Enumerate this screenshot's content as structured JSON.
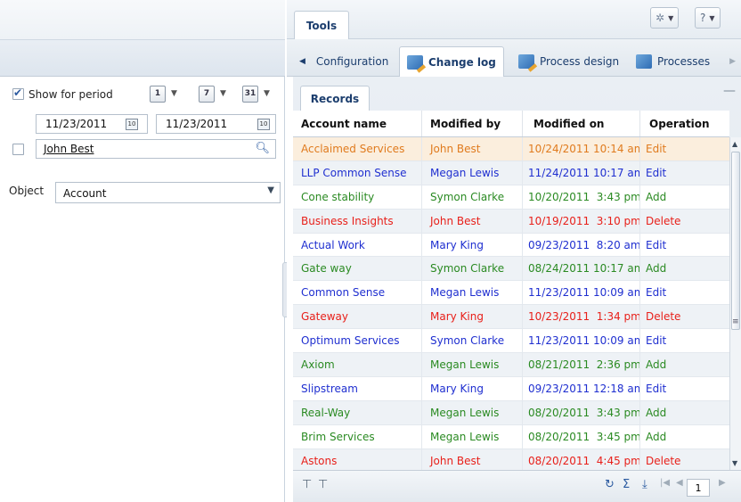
{
  "filters": {
    "show_for_period_label": "Show for period",
    "show_for_period_checked": true,
    "period_buttons": [
      {
        "icon": "day-calendar-icon",
        "label": "1"
      },
      {
        "icon": "week-calendar-icon",
        "label": "7"
      },
      {
        "icon": "month-calendar-icon",
        "label": "31"
      }
    ],
    "date_from": "11/23/2011",
    "date_to": "11/23/2011",
    "user_value": "John Best",
    "object_label": "Object",
    "object_value": "Account"
  },
  "tools": {
    "tab_label": "Tools"
  },
  "process_tabs": [
    {
      "label": "Configuration",
      "icon": "arrow-left-icon",
      "active": false
    },
    {
      "label": "Change log",
      "icon": "change-log-icon",
      "active": true
    },
    {
      "label": "Process design",
      "icon": "process-design-icon",
      "active": false
    },
    {
      "label": "Processes",
      "icon": "processes-icon",
      "active": false
    }
  ],
  "records": {
    "tab_label": "Records",
    "columns": [
      "Account name",
      "Modified by",
      "Modified on",
      "Operation"
    ],
    "rows": [
      {
        "account": "Acclaimed Services",
        "modified_by": "John Best",
        "modified_on": "10/24/2011 10:14 am",
        "operation": "Edit",
        "color": "#e07b1e",
        "selected": true
      },
      {
        "account": "LLP Common Sense",
        "modified_by": "Megan Lewis",
        "modified_on": "11/24/2011 10:17 am",
        "operation": "Edit",
        "color": "#1f2fd0"
      },
      {
        "account": "Cone stability",
        "modified_by": "Symon Clarke",
        "modified_on": "10/20/2011  3:43 pm",
        "operation": "Add",
        "color": "#2a8a22"
      },
      {
        "account": "Business Insights",
        "modified_by": "John Best",
        "modified_on": "10/19/2011  3:10 pm",
        "operation": "Delete",
        "color": "#e8201a"
      },
      {
        "account": "Actual Work",
        "modified_by": "Mary King",
        "modified_on": "09/23/2011  8:20 am",
        "operation": "Edit",
        "color": "#1f2fd0"
      },
      {
        "account": "Gate way",
        "modified_by": "Symon Clarke",
        "modified_on": "08/24/2011 10:17 am",
        "operation": "Add",
        "color": "#2a8a22"
      },
      {
        "account": "Common Sense",
        "modified_by": "Megan Lewis",
        "modified_on": "11/23/2011 10:09 am",
        "operation": "Edit",
        "color": "#1f2fd0"
      },
      {
        "account": "Gateway",
        "modified_by": "Mary King",
        "modified_on": "10/23/2011  1:34 pm",
        "operation": "Delete",
        "color": "#e8201a"
      },
      {
        "account": "Optimum Services",
        "modified_by": "Symon Clarke",
        "modified_on": "11/23/2011 10:09 am",
        "operation": "Edit",
        "color": "#1f2fd0"
      },
      {
        "account": "Axiom",
        "modified_by": "Megan Lewis",
        "modified_on": "08/21/2011  2:36 pm",
        "operation": "Add",
        "color": "#2a8a22"
      },
      {
        "account": "Slipstream",
        "modified_by": "Mary King",
        "modified_on": "09/23/2011 12:18 am",
        "operation": "Edit",
        "color": "#1f2fd0"
      },
      {
        "account": "Real-Way",
        "modified_by": "Megan Lewis",
        "modified_on": "08/20/2011  3:43 pm",
        "operation": "Add",
        "color": "#2a8a22"
      },
      {
        "account": "Brim Services",
        "modified_by": "Megan Lewis",
        "modified_on": "08/20/2011  3:45 pm",
        "operation": "Add",
        "color": "#2a8a22"
      },
      {
        "account": "Astons",
        "modified_by": "John Best",
        "modified_on": "08/20/2011  4:45 pm",
        "operation": "Delete",
        "color": "#e8201a"
      }
    ],
    "page": "1"
  }
}
